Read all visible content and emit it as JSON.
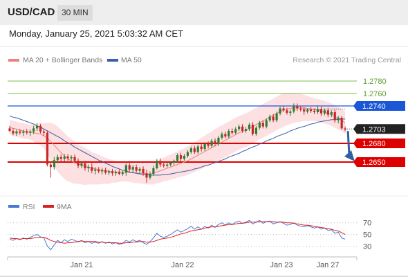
{
  "header": {
    "pair": "USD/CAD",
    "timeframe": "30 MIN"
  },
  "datetime": "Monday, January 25, 2021 5:03:32 AM CET",
  "legend": {
    "ma20_label": "MA 20 + Bollinger Bands",
    "ma50_label": "MA 50",
    "credit": "Research © 2021 Trading Central"
  },
  "rsi_legend": {
    "rsi_label": "RSI",
    "ma_label": "9MA"
  },
  "colors": {
    "ma20": "#f08080",
    "band": "#fbd6d8",
    "ma50": "#3a5ea8",
    "bull": "#2e7d32",
    "bear": "#c62828",
    "level_green": "#7cbf4a",
    "level_blue": "#1a56d6",
    "level_red": "#dd0000",
    "current": "#222222",
    "arrow": "#2f5fa8",
    "rsi": "#4a78d6",
    "rsi_ma": "#e02020"
  },
  "chart_data": [
    {
      "type": "candlestick",
      "title": "USD/CAD 30 MIN",
      "x_ticks": [
        "Jan 21",
        "Jan 22",
        "Jan 23",
        "Jan 27"
      ],
      "ylim": [
        1.26,
        1.281
      ],
      "ohlc": [
        [
          1.2704,
          1.2708,
          1.2698,
          1.27
        ],
        [
          1.27,
          1.2704,
          1.2693,
          1.2696
        ],
        [
          1.2696,
          1.2702,
          1.2692,
          1.2699
        ],
        [
          1.2699,
          1.2703,
          1.2694,
          1.2697
        ],
        [
          1.2697,
          1.2702,
          1.2692,
          1.2699
        ],
        [
          1.2699,
          1.2703,
          1.2694,
          1.2697
        ],
        [
          1.2697,
          1.2702,
          1.2692,
          1.2699
        ],
        [
          1.2699,
          1.2708,
          1.2695,
          1.2704
        ],
        [
          1.2704,
          1.2712,
          1.27,
          1.2708
        ],
        [
          1.2708,
          1.2711,
          1.2696,
          1.2699
        ],
        [
          1.2699,
          1.2703,
          1.2692,
          1.2697
        ],
        [
          1.2697,
          1.27,
          1.2643,
          1.2646
        ],
        [
          1.2646,
          1.265,
          1.2625,
          1.2642
        ],
        [
          1.2642,
          1.2658,
          1.2638,
          1.2653
        ],
        [
          1.2653,
          1.2662,
          1.2648,
          1.2658
        ],
        [
          1.2658,
          1.2662,
          1.265,
          1.2655
        ],
        [
          1.2655,
          1.2663,
          1.2651,
          1.2659
        ],
        [
          1.2659,
          1.2663,
          1.2652,
          1.2656
        ],
        [
          1.2656,
          1.2661,
          1.2652,
          1.2658
        ],
        [
          1.2658,
          1.2662,
          1.2648,
          1.2652
        ],
        [
          1.2652,
          1.2656,
          1.264,
          1.2644
        ],
        [
          1.2644,
          1.2652,
          1.264,
          1.2648
        ],
        [
          1.2648,
          1.2652,
          1.2636,
          1.264
        ],
        [
          1.264,
          1.2646,
          1.2634,
          1.2642
        ],
        [
          1.2642,
          1.2648,
          1.2632,
          1.2636
        ],
        [
          1.2636,
          1.2642,
          1.263,
          1.2638
        ],
        [
          1.2638,
          1.2642,
          1.2632,
          1.2635
        ],
        [
          1.2635,
          1.2641,
          1.263,
          1.2637
        ],
        [
          1.2637,
          1.2641,
          1.263,
          1.2633
        ],
        [
          1.2633,
          1.2638,
          1.2629,
          1.2635
        ],
        [
          1.2635,
          1.2639,
          1.2628,
          1.2632
        ],
        [
          1.2632,
          1.2637,
          1.2628,
          1.2634
        ],
        [
          1.2634,
          1.2638,
          1.2629,
          1.2631
        ],
        [
          1.2631,
          1.2636,
          1.2628,
          1.2633
        ],
        [
          1.2633,
          1.2648,
          1.2628,
          1.2645
        ],
        [
          1.2645,
          1.2652,
          1.2635,
          1.2638
        ],
        [
          1.2638,
          1.2645,
          1.2632,
          1.2642
        ],
        [
          1.2642,
          1.2646,
          1.2633,
          1.2636
        ],
        [
          1.2636,
          1.2642,
          1.2631,
          1.2639
        ],
        [
          1.2639,
          1.2643,
          1.2628,
          1.2632
        ],
        [
          1.2632,
          1.2638,
          1.2617,
          1.2625
        ],
        [
          1.2625,
          1.2635,
          1.2622,
          1.2631
        ],
        [
          1.2631,
          1.2644,
          1.2628,
          1.264
        ],
        [
          1.264,
          1.2655,
          1.2638,
          1.2652
        ],
        [
          1.2652,
          1.2656,
          1.2642,
          1.2646
        ],
        [
          1.2646,
          1.265,
          1.2641,
          1.2644
        ],
        [
          1.2644,
          1.2649,
          1.2641,
          1.2646
        ],
        [
          1.2646,
          1.2651,
          1.2643,
          1.2649
        ],
        [
          1.2649,
          1.2654,
          1.2645,
          1.2652
        ],
        [
          1.2652,
          1.2664,
          1.2649,
          1.2661
        ],
        [
          1.2661,
          1.2665,
          1.2651,
          1.2655
        ],
        [
          1.2655,
          1.2663,
          1.2652,
          1.266
        ],
        [
          1.266,
          1.2669,
          1.2657,
          1.2666
        ],
        [
          1.2666,
          1.2675,
          1.2663,
          1.2672
        ],
        [
          1.2672,
          1.2676,
          1.2663,
          1.2666
        ],
        [
          1.2666,
          1.2678,
          1.2663,
          1.2675
        ],
        [
          1.2675,
          1.2679,
          1.2667,
          1.2671
        ],
        [
          1.2671,
          1.2682,
          1.2668,
          1.2679
        ],
        [
          1.2679,
          1.2683,
          1.2672,
          1.2676
        ],
        [
          1.2676,
          1.2687,
          1.2673,
          1.2684
        ],
        [
          1.2684,
          1.2688,
          1.2675,
          1.2679
        ],
        [
          1.2679,
          1.2692,
          1.2676,
          1.2689
        ],
        [
          1.2689,
          1.2698,
          1.2686,
          1.2695
        ],
        [
          1.2695,
          1.2699,
          1.2688,
          1.2691
        ],
        [
          1.2691,
          1.2703,
          1.2688,
          1.27
        ],
        [
          1.27,
          1.2704,
          1.2694,
          1.2697
        ],
        [
          1.2697,
          1.2706,
          1.2694,
          1.2703
        ],
        [
          1.2703,
          1.271,
          1.27,
          1.2707
        ],
        [
          1.2707,
          1.2711,
          1.2697,
          1.27
        ],
        [
          1.27,
          1.2706,
          1.2697,
          1.2703
        ],
        [
          1.2703,
          1.2713,
          1.27,
          1.271
        ],
        [
          1.271,
          1.2714,
          1.2692,
          1.2695
        ],
        [
          1.2695,
          1.2708,
          1.2692,
          1.2705
        ],
        [
          1.2705,
          1.2716,
          1.2702,
          1.2713
        ],
        [
          1.2713,
          1.2717,
          1.2704,
          1.2707
        ],
        [
          1.2707,
          1.272,
          1.2704,
          1.2717
        ],
        [
          1.2717,
          1.2726,
          1.2714,
          1.2723
        ],
        [
          1.2723,
          1.2727,
          1.2714,
          1.2717
        ],
        [
          1.2717,
          1.2731,
          1.2714,
          1.2728
        ],
        [
          1.2728,
          1.2739,
          1.2725,
          1.2736
        ],
        [
          1.2736,
          1.274,
          1.273,
          1.2733
        ],
        [
          1.2733,
          1.2737,
          1.2726,
          1.2729
        ],
        [
          1.2729,
          1.2734,
          1.2724,
          1.2731
        ],
        [
          1.2731,
          1.2744,
          1.2728,
          1.274
        ],
        [
          1.274,
          1.2744,
          1.2732,
          1.2736
        ],
        [
          1.2736,
          1.274,
          1.2731,
          1.2734
        ],
        [
          1.2734,
          1.2738,
          1.2726,
          1.2731
        ],
        [
          1.2731,
          1.2736,
          1.2728,
          1.2734
        ],
        [
          1.2734,
          1.2738,
          1.2729,
          1.2732
        ],
        [
          1.2732,
          1.2736,
          1.2727,
          1.273
        ],
        [
          1.273,
          1.2741,
          1.2727,
          1.2735
        ],
        [
          1.2735,
          1.2739,
          1.2724,
          1.2728
        ],
        [
          1.2728,
          1.2736,
          1.2725,
          1.2733
        ],
        [
          1.2733,
          1.2737,
          1.2722,
          1.2726
        ],
        [
          1.2726,
          1.2733,
          1.2722,
          1.273
        ],
        [
          1.273,
          1.2734,
          1.2713,
          1.2717
        ],
        [
          1.2717,
          1.2724,
          1.2712,
          1.2721
        ],
        [
          1.2721,
          1.2724,
          1.2702,
          1.2704
        ],
        [
          1.2704,
          1.2707,
          1.2699,
          1.2702
        ]
      ],
      "ma20": [
        1.2706,
        1.2704,
        1.2703,
        1.2701,
        1.27,
        1.2699,
        1.2698,
        1.2697,
        1.2696,
        1.2695,
        1.2692,
        1.2688,
        1.2683,
        1.2677,
        1.2671,
        1.2665,
        1.266,
        1.2655,
        1.2652,
        1.2649,
        1.2647,
        1.2645,
        1.2643,
        1.2642,
        1.264,
        1.2639,
        1.2638,
        1.2637,
        1.2636,
        1.2635,
        1.2635,
        1.2634,
        1.2634,
        1.2634,
        1.2634,
        1.2633,
        1.2633,
        1.2632,
        1.2632,
        1.2632,
        1.2631,
        1.2631,
        1.2632,
        1.2634,
        1.2636,
        1.2638,
        1.264,
        1.2642,
        1.2644,
        1.2646,
        1.2648,
        1.265,
        1.2652,
        1.2655,
        1.2658,
        1.2661,
        1.2664,
        1.2667,
        1.267,
        1.2673,
        1.2676,
        1.2679,
        1.2682,
        1.2685,
        1.2688,
        1.2691,
        1.2694,
        1.2697,
        1.2699,
        1.2701,
        1.2704,
        1.2707,
        1.271,
        1.2713,
        1.2716,
        1.2719,
        1.2722,
        1.2725,
        1.2728,
        1.2731,
        1.2734,
        1.2735,
        1.2736,
        1.2737,
        1.2737,
        1.2737,
        1.2737,
        1.2736,
        1.2735,
        1.2734,
        1.2733,
        1.2732,
        1.273,
        1.2728,
        1.2726,
        1.2723,
        1.272,
        1.2717,
        1.2713
      ],
      "bb_width": [
        0.0012,
        0.0012,
        0.0012,
        0.0012,
        0.0012,
        0.0012,
        0.0012,
        0.0014,
        0.0016,
        0.0018,
        0.002,
        0.0025,
        0.003,
        0.0034,
        0.0036,
        0.0037,
        0.0037,
        0.0036,
        0.0035,
        0.0034,
        0.0032,
        0.0031,
        0.003,
        0.0028,
        0.0026,
        0.0025,
        0.0024,
        0.0022,
        0.0021,
        0.002,
        0.0018,
        0.0017,
        0.0016,
        0.0015,
        0.0015,
        0.0015,
        0.0016,
        0.0016,
        0.0016,
        0.0017,
        0.0017,
        0.0017,
        0.0018,
        0.0018,
        0.0019,
        0.0019,
        0.002,
        0.002,
        0.0021,
        0.0021,
        0.0022,
        0.0022,
        0.0023,
        0.0023,
        0.0024,
        0.0024,
        0.0025,
        0.0025,
        0.0026,
        0.0026,
        0.0027,
        0.0027,
        0.0027,
        0.0027,
        0.0027,
        0.0027,
        0.0027,
        0.0027,
        0.0027,
        0.0027,
        0.0027,
        0.0027,
        0.0027,
        0.0027,
        0.0027,
        0.0027,
        0.0027,
        0.0027,
        0.0027,
        0.0027,
        0.0027,
        0.0026,
        0.0025,
        0.0024,
        0.0023,
        0.0022,
        0.0021,
        0.002,
        0.0019,
        0.0018,
        0.0018,
        0.0018,
        0.0018,
        0.0018,
        0.0018,
        0.0018,
        0.0018,
        0.0018,
        0.0018
      ],
      "ma50": [
        1.2724,
        1.2722,
        1.2721,
        1.2719,
        1.2717,
        1.2715,
        1.2713,
        1.2711,
        1.2708,
        1.2706,
        1.2703,
        1.27,
        1.2697,
        1.2694,
        1.2691,
        1.2688,
        1.2684,
        1.2681,
        1.2678,
        1.2674,
        1.2671,
        1.2668,
        1.2665,
        1.2662,
        1.2659,
        1.2656,
        1.2653,
        1.2651,
        1.2648,
        1.2646,
        1.2643,
        1.2641,
        1.2639,
        1.2637,
        1.2636,
        1.2634,
        1.2633,
        1.2632,
        1.2631,
        1.263,
        1.263,
        1.2629,
        1.2629,
        1.2629,
        1.2629,
        1.263,
        1.263,
        1.2631,
        1.2632,
        1.2633,
        1.2634,
        1.2635,
        1.2636,
        1.2637,
        1.2639,
        1.264,
        1.2642,
        1.2644,
        1.2645,
        1.2647,
        1.2649,
        1.2651,
        1.2653,
        1.2655,
        1.2658,
        1.266,
        1.2662,
        1.2664,
        1.2667,
        1.2669,
        1.2672,
        1.2674,
        1.2676,
        1.2679,
        1.2681,
        1.2684,
        1.2686,
        1.2688,
        1.2691,
        1.2693,
        1.2695,
        1.2697,
        1.27,
        1.2702,
        1.2704,
        1.2706,
        1.2707,
        1.2709,
        1.2711,
        1.2712,
        1.2714,
        1.2715,
        1.2716,
        1.2717,
        1.2718,
        1.2718,
        1.2719,
        1.2719,
        1.2719
      ],
      "levels": [
        {
          "value": 1.278,
          "label": "1.2780",
          "kind": "green"
        },
        {
          "value": 1.276,
          "label": "1.2760",
          "kind": "green"
        },
        {
          "value": 1.274,
          "label": "1.2740",
          "kind": "blue"
        },
        {
          "value": 1.2703,
          "label": "1.2703",
          "kind": "current"
        },
        {
          "value": 1.268,
          "label": "1.2680",
          "kind": "red"
        },
        {
          "value": 1.265,
          "label": "1.2650",
          "kind": "red"
        }
      ],
      "pivot": 1.2735,
      "arrow_target": 1.265
    },
    {
      "type": "line",
      "title": "RSI",
      "yticks": [
        "70",
        "50",
        "30"
      ],
      "ylim": [
        20,
        85
      ],
      "series": [
        {
          "name": "RSI",
          "values": [
            42,
            40,
            43,
            41,
            44,
            42,
            45,
            48,
            50,
            46,
            44,
            30,
            24,
            32,
            40,
            36,
            41,
            38,
            42,
            40,
            37,
            40,
            36,
            38,
            35,
            37,
            35,
            38,
            35,
            37,
            34,
            36,
            33,
            35,
            40,
            37,
            41,
            38,
            40,
            36,
            33,
            38,
            44,
            52,
            47,
            45,
            47,
            50,
            54,
            58,
            54,
            57,
            60,
            64,
            59,
            63,
            59,
            64,
            61,
            66,
            62,
            67,
            70,
            66,
            70,
            67,
            71,
            73,
            69,
            71,
            74,
            68,
            71,
            74,
            69,
            72,
            73,
            68,
            70,
            72,
            69,
            66,
            67,
            70,
            66,
            64,
            63,
            65,
            63,
            61,
            63,
            59,
            61,
            57,
            58,
            52,
            54,
            44,
            42
          ]
        },
        {
          "name": "9MA",
          "values": [
            44,
            43,
            43,
            42,
            43,
            43,
            43,
            44,
            45,
            45,
            45,
            43,
            40,
            38,
            37,
            36,
            35,
            36,
            36,
            37,
            38,
            39,
            38,
            38,
            38,
            38,
            37,
            37,
            36,
            36,
            36,
            36,
            35,
            35,
            36,
            36,
            37,
            37,
            38,
            38,
            37,
            37,
            38,
            40,
            42,
            43,
            44,
            45,
            47,
            49,
            51,
            52,
            54,
            56,
            57,
            58,
            59,
            61,
            62,
            63,
            63,
            64,
            65,
            66,
            67,
            67,
            68,
            69,
            69,
            70,
            71,
            71,
            71,
            72,
            72,
            72,
            72,
            72,
            71,
            71,
            71,
            70,
            70,
            69,
            68,
            67,
            66,
            66,
            65,
            64,
            63,
            62,
            61,
            60,
            59,
            57,
            56,
            53,
            50
          ]
        }
      ]
    }
  ]
}
